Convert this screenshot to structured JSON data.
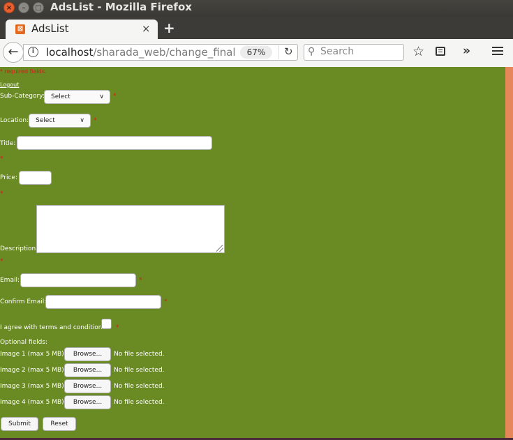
{
  "window": {
    "title": "AdsList - Mozilla Firefox"
  },
  "tab": {
    "title": "AdsList",
    "close": "×",
    "new_tab": "+"
  },
  "navbar": {
    "back": "←",
    "url_host": "localhost",
    "url_path": "/sharada_web/change_final",
    "zoom": "67%",
    "reload": "↻",
    "search_placeholder": "Search",
    "search_icon": "⚲",
    "bookmark_star": "☆",
    "overflow": "»"
  },
  "form": {
    "required_note": "* required fields.",
    "logout": "Logout",
    "subcategory": {
      "label": "Sub-Category:",
      "value": "Select",
      "required": "*"
    },
    "location": {
      "label": "Location:",
      "value": "Select",
      "required": "*"
    },
    "title": {
      "label": "Title:",
      "value": "",
      "required": "*"
    },
    "price": {
      "label": "Price:",
      "value": "",
      "required": "*"
    },
    "description": {
      "label": "Description:",
      "value": "",
      "required": "*"
    },
    "email": {
      "label": "Email:",
      "value": "",
      "required": "*"
    },
    "confirm_email": {
      "label": "Confirm Email:",
      "value": "",
      "required": "*"
    },
    "terms": {
      "label": "I agree with terms and conditions",
      "checked": false,
      "required": "*"
    },
    "optional_heading": "Optional fields:",
    "images": [
      {
        "label": "Image 1 (max 5 MB):",
        "button": "Browse...",
        "status": "No file selected."
      },
      {
        "label": "Image 2 (max 5 MB):",
        "button": "Browse...",
        "status": "No file selected."
      },
      {
        "label": "Image 3 (max 5 MB):",
        "button": "Browse...",
        "status": "No file selected."
      },
      {
        "label": "Image 4 (max 5 MB):",
        "button": "Browse...",
        "status": "No file selected."
      }
    ],
    "submit": "Submit",
    "reset": "Reset"
  },
  "colors": {
    "page_background": "#6a8a23",
    "required_marker": "#d0201a",
    "scrollbar": "#e6875a",
    "close_button": "#e95f2f"
  }
}
